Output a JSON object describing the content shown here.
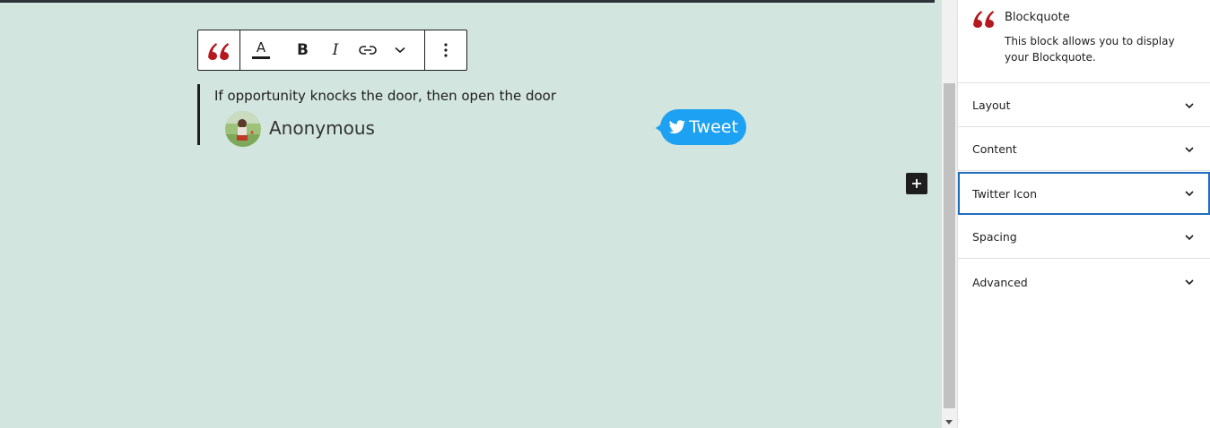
{
  "toolbar": {
    "quote_icon": "quote-icon",
    "color_label": "A",
    "bold_label": "B",
    "italic_label": "I",
    "link_icon": "link-icon",
    "more_icon": "chevron-down-icon",
    "options_icon": "vertical-ellipsis-icon"
  },
  "quote": {
    "text": "If opportunity knocks the door, then open the door",
    "author": "Anonymous",
    "tweet_label": "Tweet"
  },
  "sidebar": {
    "block_title": "Blockquote",
    "block_description": "This block allows you to display your Blockquote.",
    "panels": [
      {
        "label": "Layout"
      },
      {
        "label": "Content"
      },
      {
        "label": "Twitter Icon"
      },
      {
        "label": "Spacing"
      },
      {
        "label": "Advanced"
      }
    ]
  },
  "colors": {
    "canvas_bg": "#d3e5df",
    "quote_icon": "#b5181f",
    "tweet": "#1da1f2",
    "active_panel_border": "#1f6dbf"
  }
}
